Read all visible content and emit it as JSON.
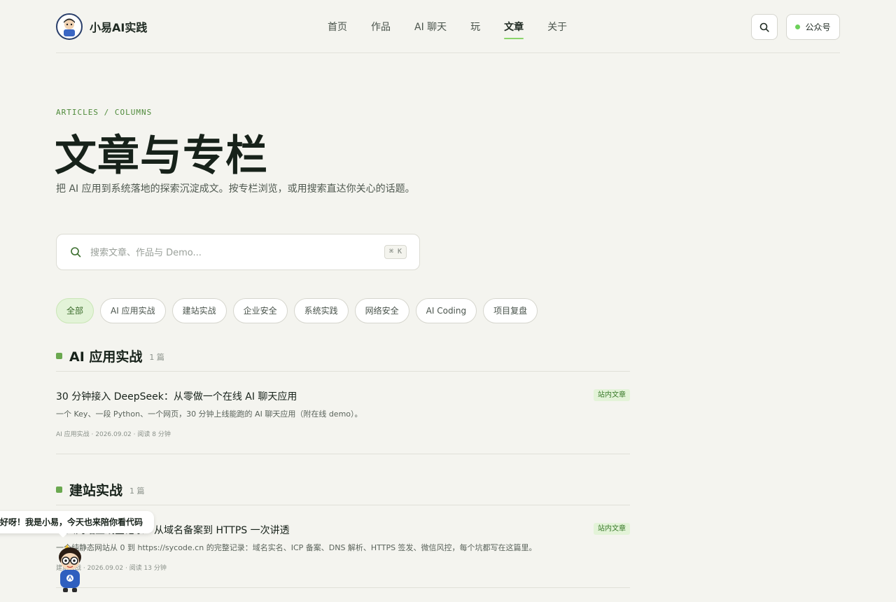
{
  "header": {
    "brand_name": "小易AI实践",
    "nav": [
      "首页",
      "作品",
      "AI 聊天",
      "玩",
      "文章",
      "关于"
    ],
    "active_nav_index": 4,
    "wechat_label": "公众号",
    "status_color": "#6cd15a"
  },
  "hero": {
    "eyebrow": "ARTICLES / COLUMNS",
    "title": "文章与专栏",
    "subtitle": "把 AI 应用到系统落地的探索沉淀成文。按专栏浏览，或用搜索直达你关心的话题。"
  },
  "search": {
    "placeholder": "搜索文章、作品与 Demo...",
    "value": "",
    "shortcut": "⌘ K"
  },
  "filters": {
    "chips": [
      "全部",
      "AI 应用实战",
      "建站实战",
      "企业安全",
      "系统实践",
      "网络安全",
      "AI Coding",
      "项目复盘"
    ],
    "active_index": 0
  },
  "sections": [
    {
      "title": "AI 应用实战",
      "count": "1 篇",
      "articles": [
        {
          "title": "30 分钟接入 DeepSeek：从零做一个在线 AI 聊天应用",
          "tag": "站内文章",
          "desc": "一个 Key、一段 Python、一个网页，30 分钟上线能跑的 AI 聊天应用（附在线 demo）。",
          "meta": "AI 应用实战 · 2026.09.02 · 阅读 8 分钟"
        }
      ]
    },
    {
      "title": "建站实战",
      "count": "1 篇",
      "articles": [
        {
          "title": "个人网站上线全记录：从域名备案到 HTTPS 一次讲透",
          "tag": "站内文章",
          "desc": "一个纯静态网站从 0 到 https://sycode.cn 的完整记录：域名实名、ICP 备案、DNS 解析、HTTPS 签发、微信风控，每个坑都写在这篇里。",
          "meta": "建站实战 · 2026.09.02 · 阅读 13 分钟"
        }
      ]
    }
  ],
  "mascot": {
    "greeting": "好呀！我是小易，今天也来陪你看代码"
  },
  "colors": {
    "accent": "#8bd46b",
    "tag_bg": "#e3f3d8",
    "background": "#f4f4ef"
  }
}
